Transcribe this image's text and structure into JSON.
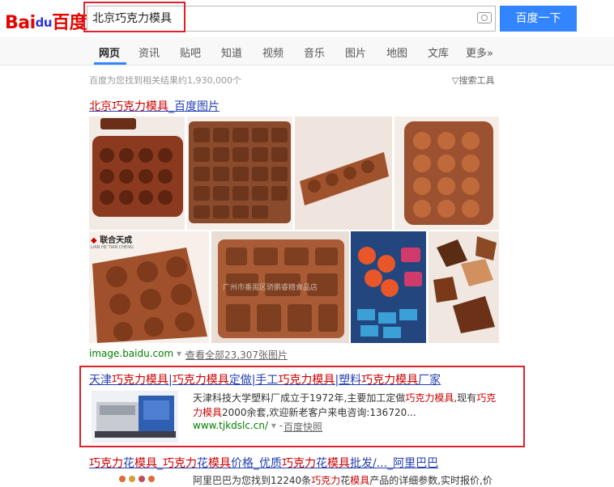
{
  "header": {
    "logo_text": "Bai",
    "logo_du": "du",
    "logo_cn": "百度",
    "search_value": "北京巧克力模具",
    "search_button": "百度一下"
  },
  "nav": {
    "tabs": [
      "网页",
      "资讯",
      "贴吧",
      "知道",
      "视频",
      "音乐",
      "图片",
      "地图",
      "文库",
      "更多»"
    ],
    "active": "网页"
  },
  "result_count": "百度为您找到相关结果约1,930,000个",
  "search_tools": "搜索工具",
  "result1": {
    "title_em": "北京巧克力模具",
    "title_rest": "_百度图片",
    "source": "image.baidu.com",
    "view_all": "查看全部23,307张图片",
    "logo_overlay": "联合天成",
    "logo_overlay_sub": "LIAN HE TIAN CHENG",
    "watermark": "广州市番禺区骄鹏睿精食品店"
  },
  "result2": {
    "title_parts": [
      "天津",
      "巧克力模具",
      "|",
      "巧克力模具",
      "定做|手工",
      "巧克力模具",
      "|塑料",
      "巧克力模具",
      "厂家"
    ],
    "snippet_a": "天津科技大学塑料厂成立于1972年,主要加工定做",
    "snippet_em1": "巧克力模具",
    "snippet_b": ",现有",
    "snippet_em2": "巧克力模具",
    "snippet_c": "2000余套,欢迎新老客户来电咨询:136720...",
    "url": "www.tjkdslc.cn/",
    "snapshot": "百度快照"
  },
  "result3": {
    "title_parts": [
      "巧克力",
      "花",
      "模具",
      "_",
      "巧克力",
      "花",
      "模具",
      "价格_优质",
      "巧克力",
      "花",
      "模具",
      "批发/..._阿里巴巴"
    ],
    "snippet_a": "阿里巴巴为您找到12240条",
    "snippet_em1": "巧克力",
    "snippet_b": "花",
    "snippet_em2": "模具",
    "snippet_c": "产品的详细参数,实时报价,价"
  },
  "colors": {
    "accent": "#3385ff",
    "link": "#2440b3",
    "highlight": "#c00",
    "annotation_red": "#e0202a",
    "url_green": "#008000"
  }
}
